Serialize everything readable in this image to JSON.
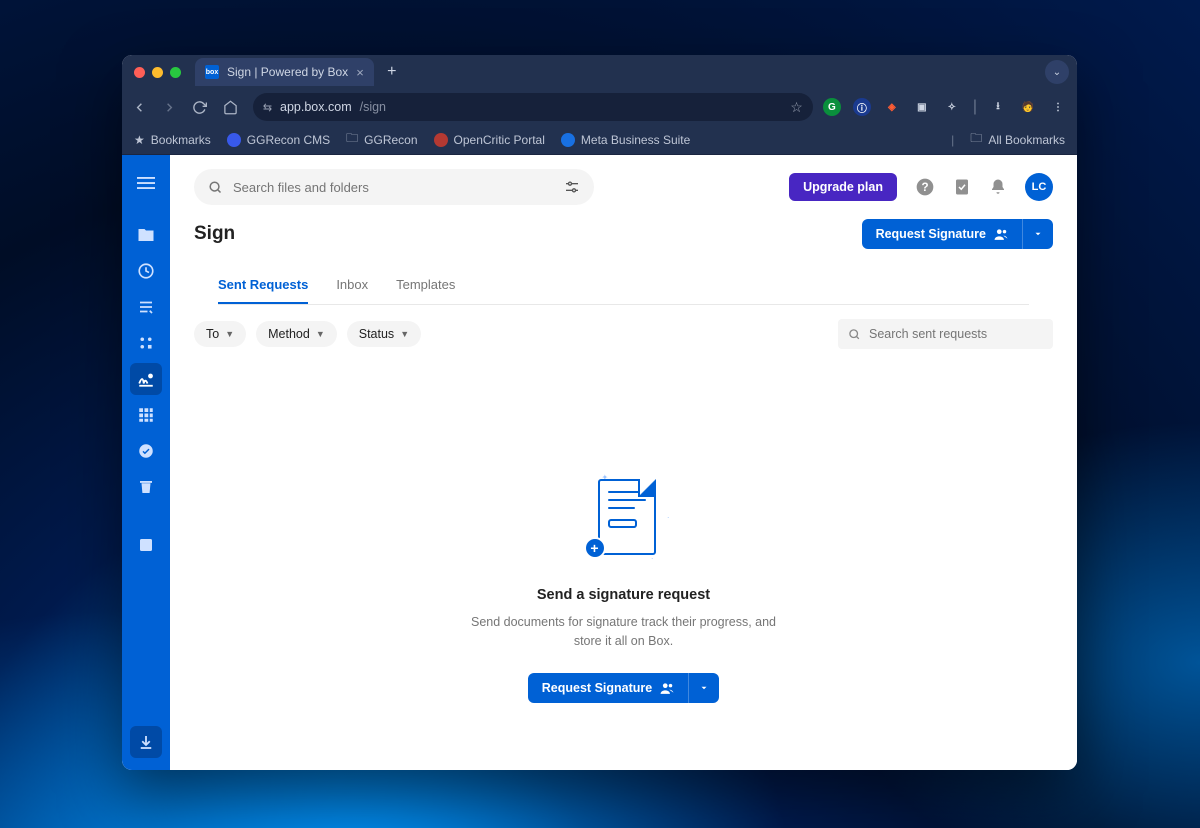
{
  "browser": {
    "tab_title": "Sign | Powered by Box",
    "url_host": "app.box.com",
    "url_path": "/sign",
    "bookmarks_label": "Bookmarks",
    "bookmarks": [
      "GGRecon CMS",
      "GGRecon",
      "OpenCritic Portal",
      "Meta Business Suite"
    ],
    "all_bookmarks_label": "All Bookmarks"
  },
  "header": {
    "search_placeholder": "Search files and folders",
    "upgrade_label": "Upgrade plan",
    "avatar_initials": "LC"
  },
  "page": {
    "title": "Sign",
    "request_signature_label": "Request Signature"
  },
  "tabs": {
    "sent": "Sent Requests",
    "inbox": "Inbox",
    "templates": "Templates"
  },
  "filters": {
    "to": "To",
    "method": "Method",
    "status": "Status",
    "search_placeholder": "Search sent requests"
  },
  "empty": {
    "heading": "Send a signature request",
    "body": "Send documents for signature track their progress, and store it all on Box.",
    "cta": "Request Signature"
  }
}
